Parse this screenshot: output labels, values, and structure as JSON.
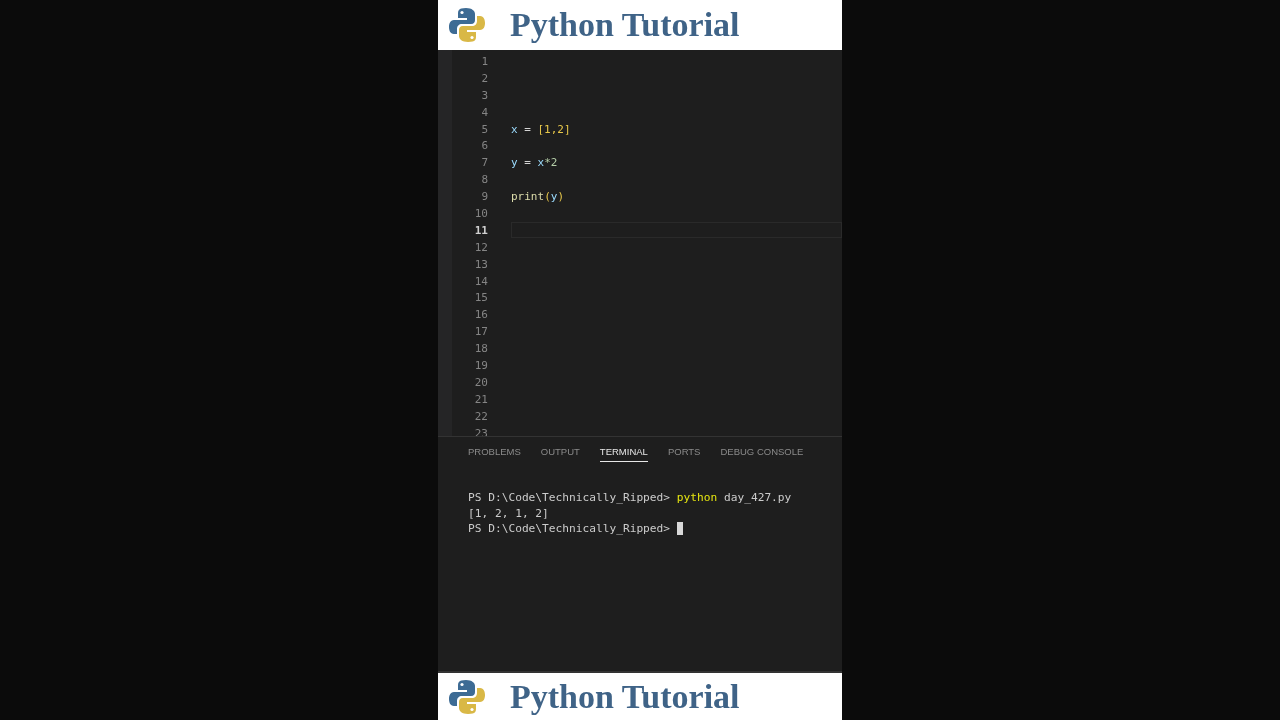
{
  "top_banner": {
    "title": "Python Tutorial"
  },
  "editor": {
    "lines": [
      {
        "number": "1",
        "current": false
      },
      {
        "number": "2",
        "current": false
      },
      {
        "number": "3",
        "current": false
      },
      {
        "number": "4",
        "current": false
      },
      {
        "number": "5",
        "current": false,
        "tokens": [
          {
            "text": "x",
            "kind": "variable"
          },
          {
            "text": " = ",
            "kind": "operator"
          },
          {
            "text": "[1,2]",
            "kind": "bracket"
          }
        ]
      },
      {
        "number": "6",
        "current": false
      },
      {
        "number": "7",
        "current": false,
        "tokens": [
          {
            "text": "y",
            "kind": "variable"
          },
          {
            "text": " = ",
            "kind": "operator"
          },
          {
            "text": "x",
            "kind": "variable"
          },
          {
            "text": "*2",
            "kind": "number"
          }
        ]
      },
      {
        "number": "8",
        "current": false
      },
      {
        "number": "9",
        "current": false,
        "tokens": [
          {
            "text": "print",
            "kind": "function"
          },
          {
            "text": "(",
            "kind": "bracket"
          },
          {
            "text": "y",
            "kind": "variable"
          },
          {
            "text": ")",
            "kind": "bracket"
          }
        ]
      },
      {
        "number": "10",
        "current": false
      },
      {
        "number": "11",
        "current": true
      },
      {
        "number": "12",
        "current": false
      },
      {
        "number": "13",
        "current": false
      },
      {
        "number": "14",
        "current": false
      },
      {
        "number": "15",
        "current": false
      },
      {
        "number": "16",
        "current": false
      },
      {
        "number": "17",
        "current": false
      },
      {
        "number": "18",
        "current": false
      },
      {
        "number": "19",
        "current": false
      },
      {
        "number": "20",
        "current": false
      },
      {
        "number": "21",
        "current": false
      },
      {
        "number": "22",
        "current": false
      },
      {
        "number": "23",
        "current": false
      }
    ]
  },
  "panel": {
    "tabs": [
      {
        "label": "PROBLEMS",
        "selected": false
      },
      {
        "label": "OUTPUT",
        "selected": false
      },
      {
        "label": "TERMINAL",
        "selected": true
      },
      {
        "label": "PORTS",
        "selected": false
      },
      {
        "label": "DEBUG CONSOLE",
        "selected": false
      }
    ],
    "terminal_lines": [
      {
        "tokens": [
          {
            "text": "PS D:\\Code\\Technically_Ripped> ",
            "kind": "plain"
          },
          {
            "text": "python",
            "kind": "command"
          },
          {
            "text": " day_427.py",
            "kind": "plain"
          }
        ],
        "cursor": false
      },
      {
        "tokens": [
          {
            "text": "[1, 2, 1, 2]",
            "kind": "plain"
          }
        ],
        "cursor": false
      },
      {
        "tokens": [
          {
            "text": "PS D:\\Code\\Technically_Ripped> ",
            "kind": "plain"
          }
        ],
        "cursor": true
      }
    ]
  },
  "bottom_banner": {
    "title": "Python Tutorial"
  }
}
